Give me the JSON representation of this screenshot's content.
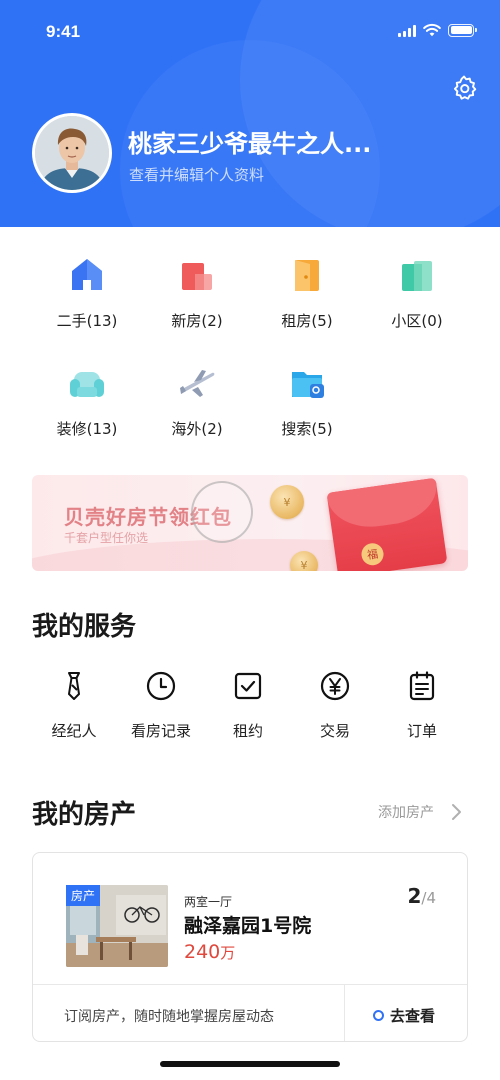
{
  "status_bar": {
    "time": "9:41"
  },
  "profile": {
    "name": "桃家三少爷最牛之人...",
    "subtitle": "查看并编辑个人资料"
  },
  "categories": [
    {
      "label": "二手(13)",
      "icon": "house-icon"
    },
    {
      "label": "新房(2)",
      "icon": "new-building-icon"
    },
    {
      "label": "租房(5)",
      "icon": "door-icon"
    },
    {
      "label": "小区(0)",
      "icon": "community-icon"
    },
    {
      "label": "装修(13)",
      "icon": "sofa-icon"
    },
    {
      "label": "海外(2)",
      "icon": "airplane-icon"
    },
    {
      "label": "搜索(5)",
      "icon": "search-folder-icon"
    }
  ],
  "banner": {
    "title": "贝壳好房节领红包",
    "subtitle": "千套户型任你选",
    "seal_text": "福"
  },
  "services": {
    "title": "我的服务",
    "items": [
      {
        "label": "经纪人",
        "icon": "tie-icon"
      },
      {
        "label": "看房记录",
        "icon": "clock-icon"
      },
      {
        "label": "租约",
        "icon": "checkbox-icon"
      },
      {
        "label": "交易",
        "icon": "yen-icon"
      },
      {
        "label": "订单",
        "icon": "clipboard-icon"
      }
    ]
  },
  "property": {
    "title": "我的房产",
    "add_label": "添加房产",
    "card": {
      "tag": "房产",
      "layout": "两室一厅",
      "name": "融泽嘉园1号院",
      "price": "240",
      "price_unit": "万",
      "page_current": "2",
      "page_total": "/4",
      "subscribe_text": "订阅房产，随时随地掌握房屋动态",
      "view_label": "去查看"
    }
  },
  "colors": {
    "brand_blue": "#3072F6",
    "price_red": "#E0483D"
  }
}
